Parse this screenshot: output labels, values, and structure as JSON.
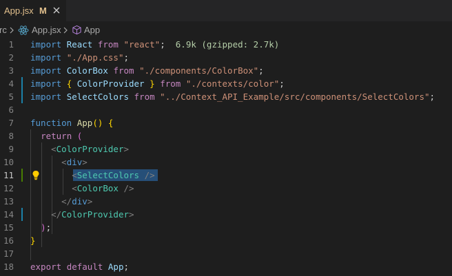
{
  "tab": {
    "filename": "App.jsx",
    "status": "M",
    "close_icon": "close-icon"
  },
  "breadcrumb": {
    "folder": "rc",
    "file": "App.jsx",
    "symbol": "App"
  },
  "editor": {
    "lines": [
      {
        "n": "1",
        "tokens": [
          [
            "kw",
            "import"
          ],
          [
            "pun",
            " "
          ],
          [
            "id",
            "React"
          ],
          [
            "pun",
            " "
          ],
          [
            "ctl",
            "from"
          ],
          [
            "pun",
            " "
          ],
          [
            "str",
            "\"react\""
          ],
          [
            "pun",
            ";"
          ],
          [
            "pun",
            "  "
          ],
          [
            "hint",
            "6.9k (gzipped: 2.7k)"
          ]
        ]
      },
      {
        "n": "2",
        "tokens": [
          [
            "kw",
            "import"
          ],
          [
            "pun",
            " "
          ],
          [
            "str",
            "\"./App.css\""
          ],
          [
            "pun",
            ";"
          ]
        ]
      },
      {
        "n": "3",
        "tokens": [
          [
            "kw",
            "import"
          ],
          [
            "pun",
            " "
          ],
          [
            "id",
            "ColorBox"
          ],
          [
            "pun",
            " "
          ],
          [
            "ctl",
            "from"
          ],
          [
            "pun",
            " "
          ],
          [
            "str",
            "\"./components/ColorBox\""
          ],
          [
            "pun",
            ";"
          ]
        ]
      },
      {
        "n": "4",
        "tokens": [
          [
            "kw",
            "import"
          ],
          [
            "pun",
            " "
          ],
          [
            "br1",
            "{"
          ],
          [
            "pun",
            " "
          ],
          [
            "id",
            "ColorProvider"
          ],
          [
            "pun",
            " "
          ],
          [
            "br1",
            "}"
          ],
          [
            "pun",
            " "
          ],
          [
            "ctl",
            "from"
          ],
          [
            "pun",
            " "
          ],
          [
            "str",
            "\"./contexts/color\""
          ],
          [
            "pun",
            ";"
          ]
        ]
      },
      {
        "n": "5",
        "tokens": [
          [
            "kw",
            "import"
          ],
          [
            "pun",
            " "
          ],
          [
            "id",
            "SelectColors"
          ],
          [
            "pun",
            " "
          ],
          [
            "ctl",
            "from"
          ],
          [
            "pun",
            " "
          ],
          [
            "str",
            "\"../Context_API_Example/src/components/SelectColors\""
          ],
          [
            "pun",
            ";"
          ]
        ]
      },
      {
        "n": "6",
        "tokens": []
      },
      {
        "n": "7",
        "tokens": [
          [
            "kw",
            "function"
          ],
          [
            "pun",
            " "
          ],
          [
            "fn",
            "App"
          ],
          [
            "br1",
            "()"
          ],
          [
            "pun",
            " "
          ],
          [
            "br1",
            "{"
          ]
        ]
      },
      {
        "n": "8",
        "tokens": [
          [
            "pun",
            "  "
          ],
          [
            "ctl",
            "return"
          ],
          [
            "pun",
            " "
          ],
          [
            "br2",
            "("
          ]
        ]
      },
      {
        "n": "9",
        "tokens": [
          [
            "pun",
            "    "
          ],
          [
            "tg",
            "<"
          ],
          [
            "tag",
            "ColorProvider"
          ],
          [
            "tg",
            ">"
          ]
        ]
      },
      {
        "n": "10",
        "tokens": [
          [
            "pun",
            "      "
          ],
          [
            "tg",
            "<"
          ],
          [
            "el",
            "div"
          ],
          [
            "tg",
            ">"
          ]
        ]
      },
      {
        "n": "11",
        "tokens": [
          [
            "pun",
            "        "
          ],
          [
            "tg",
            "<"
          ],
          [
            "tag",
            "SelectColors"
          ],
          [
            "pun",
            " "
          ],
          [
            "tg",
            "/>"
          ]
        ]
      },
      {
        "n": "12",
        "tokens": [
          [
            "pun",
            "        "
          ],
          [
            "tg",
            "<"
          ],
          [
            "tag",
            "ColorBox"
          ],
          [
            "pun",
            " "
          ],
          [
            "tg",
            "/>"
          ]
        ]
      },
      {
        "n": "13",
        "tokens": [
          [
            "pun",
            "      "
          ],
          [
            "tg",
            "</"
          ],
          [
            "el",
            "div"
          ],
          [
            "tg",
            ">"
          ]
        ]
      },
      {
        "n": "14",
        "tokens": [
          [
            "pun",
            "    "
          ],
          [
            "tg",
            "</"
          ],
          [
            "tag",
            "ColorProvider"
          ],
          [
            "tg",
            ">"
          ]
        ]
      },
      {
        "n": "15",
        "tokens": [
          [
            "pun",
            "  "
          ],
          [
            "br2",
            ")"
          ],
          [
            "pun",
            ";"
          ]
        ]
      },
      {
        "n": "16",
        "tokens": [
          [
            "br1",
            "}"
          ]
        ]
      },
      {
        "n": "17",
        "tokens": []
      },
      {
        "n": "18",
        "tokens": [
          [
            "ctl",
            "export"
          ],
          [
            "pun",
            " "
          ],
          [
            "ctl",
            "default"
          ],
          [
            "pun",
            " "
          ],
          [
            "id",
            "App"
          ],
          [
            "pun",
            ";"
          ]
        ]
      }
    ]
  },
  "colors": {
    "background": "#1e1e1e",
    "keyword": "#569cd6",
    "control": "#c586c0",
    "string": "#ce9178",
    "component": "#4ec9b0",
    "modified_gutter": "#1b81a8",
    "added_gutter": "#487e02"
  },
  "icons": {
    "react": "react-icon",
    "symbol": "cube-icon",
    "lightbulb": "lightbulb-icon",
    "chevron": "chevron-right-icon"
  }
}
